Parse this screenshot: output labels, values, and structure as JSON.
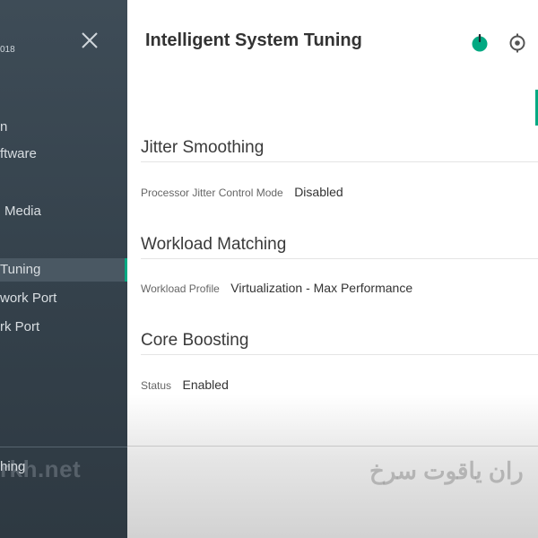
{
  "sidebar": {
    "header_text": "018",
    "items": [
      {
        "label": "n"
      },
      {
        "label": "ftware"
      },
      {
        "label": "Media"
      },
      {
        "label": "Tuning",
        "active": true
      },
      {
        "label": "work Port"
      },
      {
        "label": "rk Port"
      }
    ],
    "footer_label": "hing",
    "watermark": "rkh.net",
    "accent_color": "#01a982"
  },
  "header": {
    "title": "Intelligent System Tuning",
    "icons": [
      "power-icon",
      "locate-icon"
    ]
  },
  "sections": [
    {
      "title": "Jitter Smoothing",
      "field": {
        "label": "Processor Jitter Control Mode",
        "value": "Disabled"
      }
    },
    {
      "title": "Workload Matching",
      "field": {
        "label": "Workload Profile",
        "value": "Virtualization - Max Performance"
      }
    },
    {
      "title": "Core Boosting",
      "field": {
        "label": "Status",
        "value": "Enabled"
      }
    }
  ],
  "watermark_main": "ران یاقوت سرخ"
}
